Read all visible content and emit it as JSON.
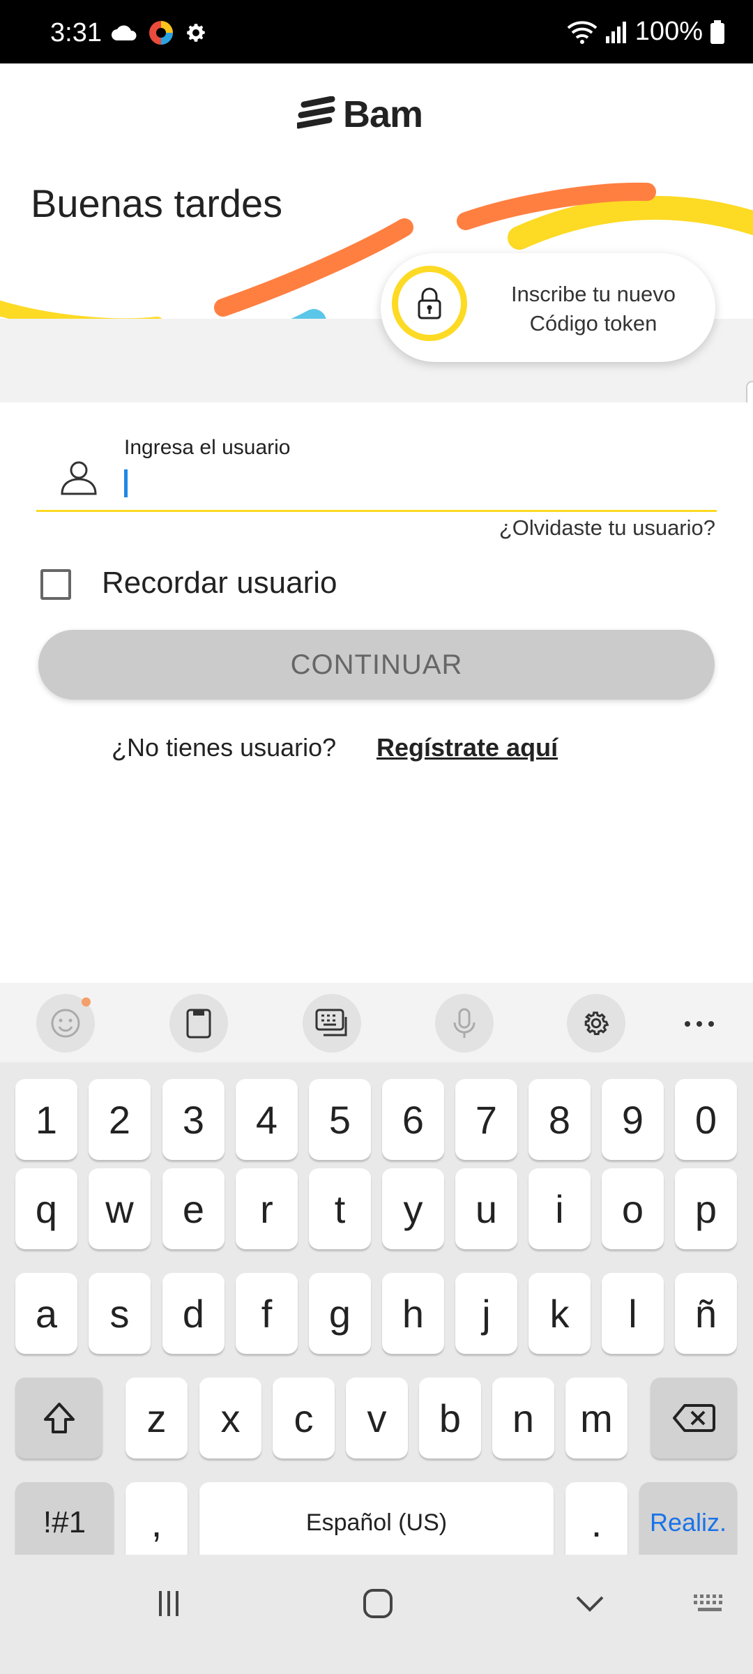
{
  "status_bar": {
    "time": "3:31",
    "battery": "100%"
  },
  "app": {
    "logo": "Bam",
    "greeting": "Buenas tardes",
    "token_card": {
      "line1": "Inscribe tu nuevo",
      "line2": "Código token"
    },
    "login": {
      "username_label": "Ingresa el usuario",
      "username_value": "",
      "forgot_link": "¿Olvidaste tu usuario?",
      "remember_label": "Recordar usuario",
      "remember_checked": false,
      "continue_button": "CONTINUAR",
      "no_user_text": "¿No tienes usuario?",
      "register_link": "Regístrate aquí"
    },
    "colors": {
      "brand_yellow": "#FDDA24",
      "brand_orange": "#FF7F41",
      "brand_blue": "#5BC6E8",
      "disabled_button": "#CBCBCB"
    }
  },
  "keyboard": {
    "toolbar": [
      "emoji-icon",
      "clipboard-icon",
      "keyboard-mode-icon",
      "microphone-icon",
      "settings-icon",
      "more-icon"
    ],
    "row_numbers": [
      "1",
      "2",
      "3",
      "4",
      "5",
      "6",
      "7",
      "8",
      "9",
      "0"
    ],
    "row1": [
      "q",
      "w",
      "e",
      "r",
      "t",
      "y",
      "u",
      "i",
      "o",
      "p"
    ],
    "row2": [
      "a",
      "s",
      "d",
      "f",
      "g",
      "h",
      "j",
      "k",
      "l",
      "ñ"
    ],
    "row3": [
      "z",
      "x",
      "c",
      "v",
      "b",
      "n",
      "m"
    ],
    "symbols_key": "!#1",
    "comma_key": ",",
    "space_key": "Español (US)",
    "period_key": ".",
    "action_key": "Realiz."
  },
  "nav_bar": [
    "recent-apps-icon",
    "home-icon",
    "back-icon",
    "keyboard-switch-icon"
  ]
}
